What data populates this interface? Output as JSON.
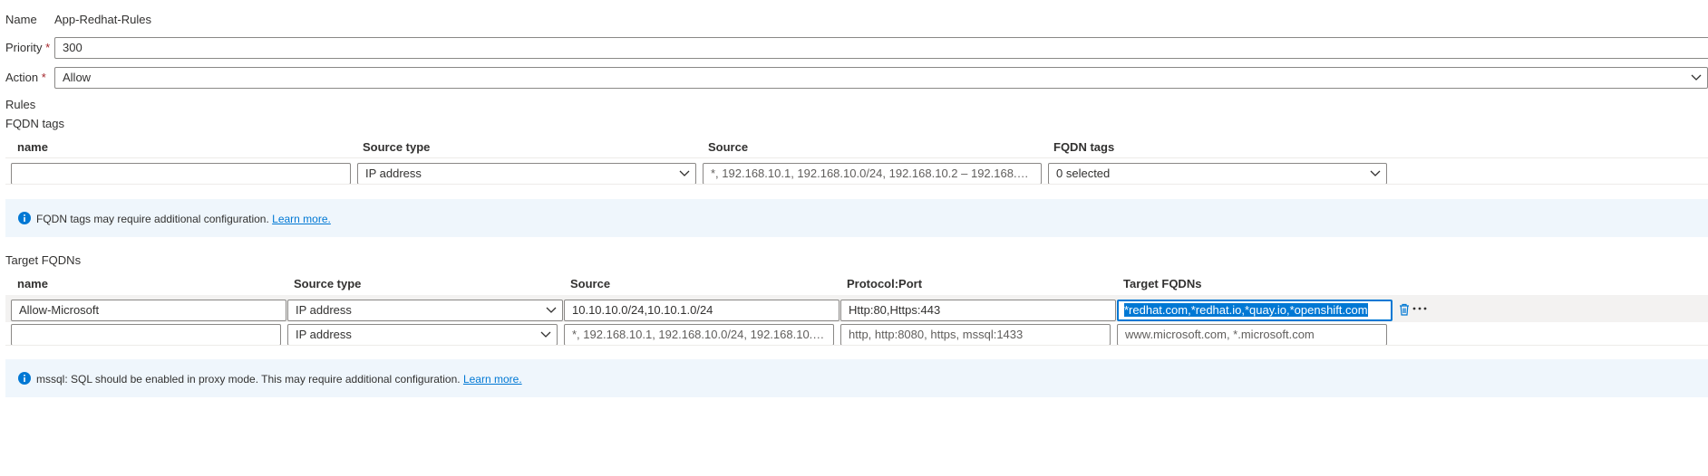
{
  "form": {
    "name_label": "Name",
    "name_value": "App-Redhat-Rules",
    "priority_label": "Priority",
    "priority_value": "300",
    "action_label": "Action",
    "action_value": "Allow",
    "required_mark": "*"
  },
  "rules_label": "Rules",
  "fqdn_tags_section": {
    "title": "FQDN tags",
    "columns": [
      "name",
      "Source type",
      "Source",
      "FQDN tags"
    ],
    "row": {
      "name_value": "",
      "source_type": "IP address",
      "source_placeholder": "*, 192.168.10.1, 192.168.10.0/24, 192.168.10.2 – 192.168.10.10",
      "fqdn_tags_value": "0 selected"
    },
    "info": {
      "text": "FQDN tags may require additional configuration.",
      "link": "Learn more."
    }
  },
  "target_fqdns_section": {
    "title": "Target FQDNs",
    "columns": [
      "name",
      "Source type",
      "Source",
      "Protocol:Port",
      "Target FQDNs"
    ],
    "rows": [
      {
        "name": "Allow-Microsoft",
        "source_type": "IP address",
        "source": "10.10.10.0/24,10.10.1.0/24",
        "protocol_port": "Http:80,Https:443",
        "target_fqdns": "*redhat.com,*redhat.io,*quay.io,*openshift.com"
      },
      {
        "name": "",
        "source_type": "IP address",
        "source_placeholder": "*, 192.168.10.1, 192.168.10.0/24, 192.168.10.2 – 192.168.1...",
        "protocol_port_placeholder": "http, http:8080, https, mssql:1433",
        "target_fqdns_placeholder": "www.microsoft.com, *.microsoft.com"
      }
    ],
    "info": {
      "text": "mssql: SQL should be enabled in proxy mode. This may require additional configuration.",
      "link": "Learn more."
    }
  },
  "icons": {
    "info": "info-icon",
    "delete": "trash-icon",
    "more": "more-ellipsis-icon",
    "dropdown": "chevron-down-icon"
  },
  "colors": {
    "accent": "#0078d4",
    "info_band": "#eff6fc",
    "required": "#a4262c",
    "border": "#8a8886"
  }
}
